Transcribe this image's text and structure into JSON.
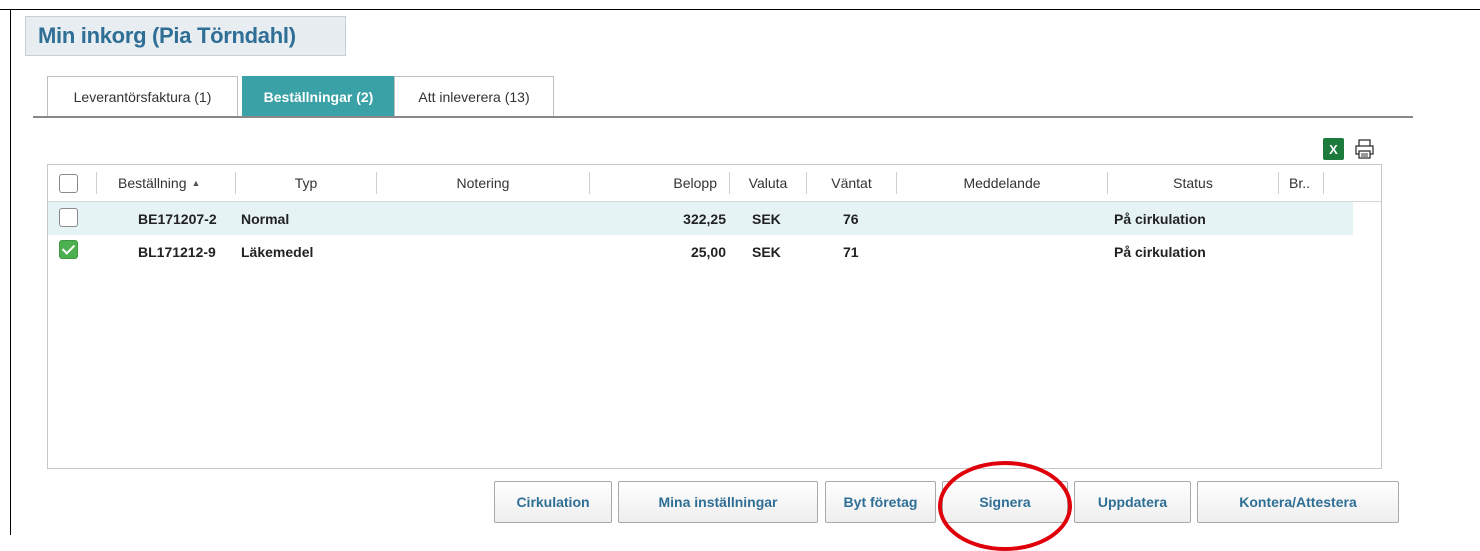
{
  "page": {
    "title": "Min inkorg (Pia Törndahl)"
  },
  "tabs": [
    {
      "label": "Leverantörsfaktura (1)",
      "active": false
    },
    {
      "label": "Beställningar (2)",
      "active": true
    },
    {
      "label": "Att inleverera (13)",
      "active": false
    }
  ],
  "toolbar": {
    "excel_icon": "excel-icon",
    "print_icon": "printer-icon"
  },
  "grid": {
    "columns": [
      "Beställning",
      "Typ",
      "Notering",
      "Belopp",
      "Valuta",
      "Väntat",
      "Meddelande",
      "Status",
      "Br.."
    ],
    "sort_indicator": "▲",
    "rows": [
      {
        "checked": false,
        "order": "BE171207-2",
        "type": "Normal",
        "note": "",
        "amount": "322,25",
        "currency": "SEK",
        "waited": "76",
        "message": "",
        "status": "På cirkulation",
        "br": ""
      },
      {
        "checked": true,
        "order": "BL171212-9",
        "type": "Läkemedel",
        "note": "",
        "amount": "25,00",
        "currency": "SEK",
        "waited": "71",
        "message": "",
        "status": "På cirkulation",
        "br": ""
      }
    ]
  },
  "buttons": {
    "cirkulation": "Cirkulation",
    "mina_installningar": "Mina inställningar",
    "byt_foretag": "Byt företag",
    "signera": "Signera",
    "uppdatera": "Uppdatera",
    "kontera_attestera": "Kontera/Attestera"
  },
  "colors": {
    "accent_tab": "#3aa1a7",
    "title": "#2f6f96",
    "annotation": "#e0000b",
    "check": "#4caf50"
  }
}
